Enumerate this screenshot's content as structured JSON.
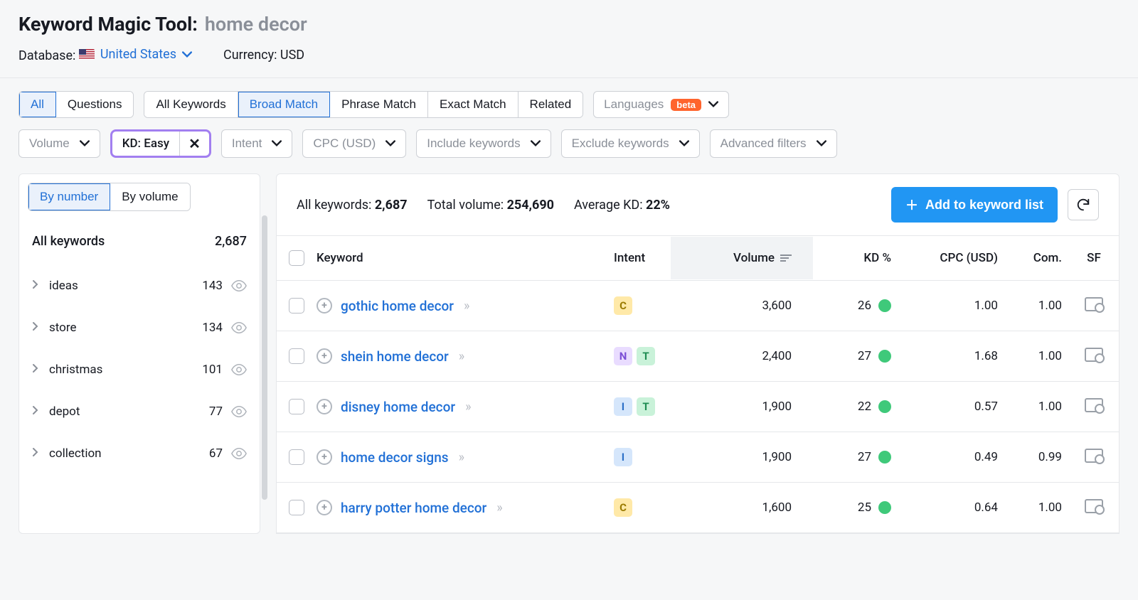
{
  "header": {
    "title_label": "Keyword Magic Tool:",
    "query": "home decor",
    "database_label": "Database:",
    "database_value": "United States",
    "currency_label": "Currency: USD"
  },
  "tabs_main": {
    "all": "All",
    "questions": "Questions"
  },
  "tabs_match": {
    "all_kw": "All Keywords",
    "broad": "Broad Match",
    "phrase": "Phrase Match",
    "exact": "Exact Match",
    "related": "Related"
  },
  "languages": {
    "label": "Languages",
    "badge": "beta"
  },
  "filters": {
    "volume": "Volume",
    "kd": "KD: Easy",
    "intent": "Intent",
    "cpc": "CPC (USD)",
    "include": "Include keywords",
    "exclude": "Exclude keywords",
    "advanced": "Advanced filters"
  },
  "sidebar": {
    "by_number": "By number",
    "by_volume": "By volume",
    "all_label": "All keywords",
    "all_count": "2,687",
    "items": [
      {
        "label": "ideas",
        "count": "143"
      },
      {
        "label": "store",
        "count": "134"
      },
      {
        "label": "christmas",
        "count": "101"
      },
      {
        "label": "depot",
        "count": "77"
      },
      {
        "label": "collection",
        "count": "67"
      }
    ]
  },
  "summary": {
    "all_kw_label": "All keywords:",
    "all_kw_val": "2,687",
    "total_vol_label": "Total volume:",
    "total_vol_val": "254,690",
    "avg_kd_label": "Average KD:",
    "avg_kd_val": "22%",
    "add_button": "Add to keyword list"
  },
  "columns": {
    "keyword": "Keyword",
    "intent": "Intent",
    "volume": "Volume",
    "kd": "KD %",
    "cpc": "CPC (USD)",
    "com": "Com.",
    "sf": "SF"
  },
  "rows": [
    {
      "keyword": "gothic home decor",
      "intents": [
        "C"
      ],
      "volume": "3,600",
      "kd": "26",
      "cpc": "1.00",
      "com": "1.00"
    },
    {
      "keyword": "shein home decor",
      "intents": [
        "N",
        "T"
      ],
      "volume": "2,400",
      "kd": "27",
      "cpc": "1.68",
      "com": "1.00"
    },
    {
      "keyword": "disney home decor",
      "intents": [
        "I",
        "T"
      ],
      "volume": "1,900",
      "kd": "22",
      "cpc": "0.57",
      "com": "1.00"
    },
    {
      "keyword": "home decor signs",
      "intents": [
        "I"
      ],
      "volume": "1,900",
      "kd": "27",
      "cpc": "0.49",
      "com": "0.99"
    },
    {
      "keyword": "harry potter home decor",
      "intents": [
        "C"
      ],
      "volume": "1,600",
      "kd": "25",
      "cpc": "0.64",
      "com": "1.00"
    }
  ]
}
